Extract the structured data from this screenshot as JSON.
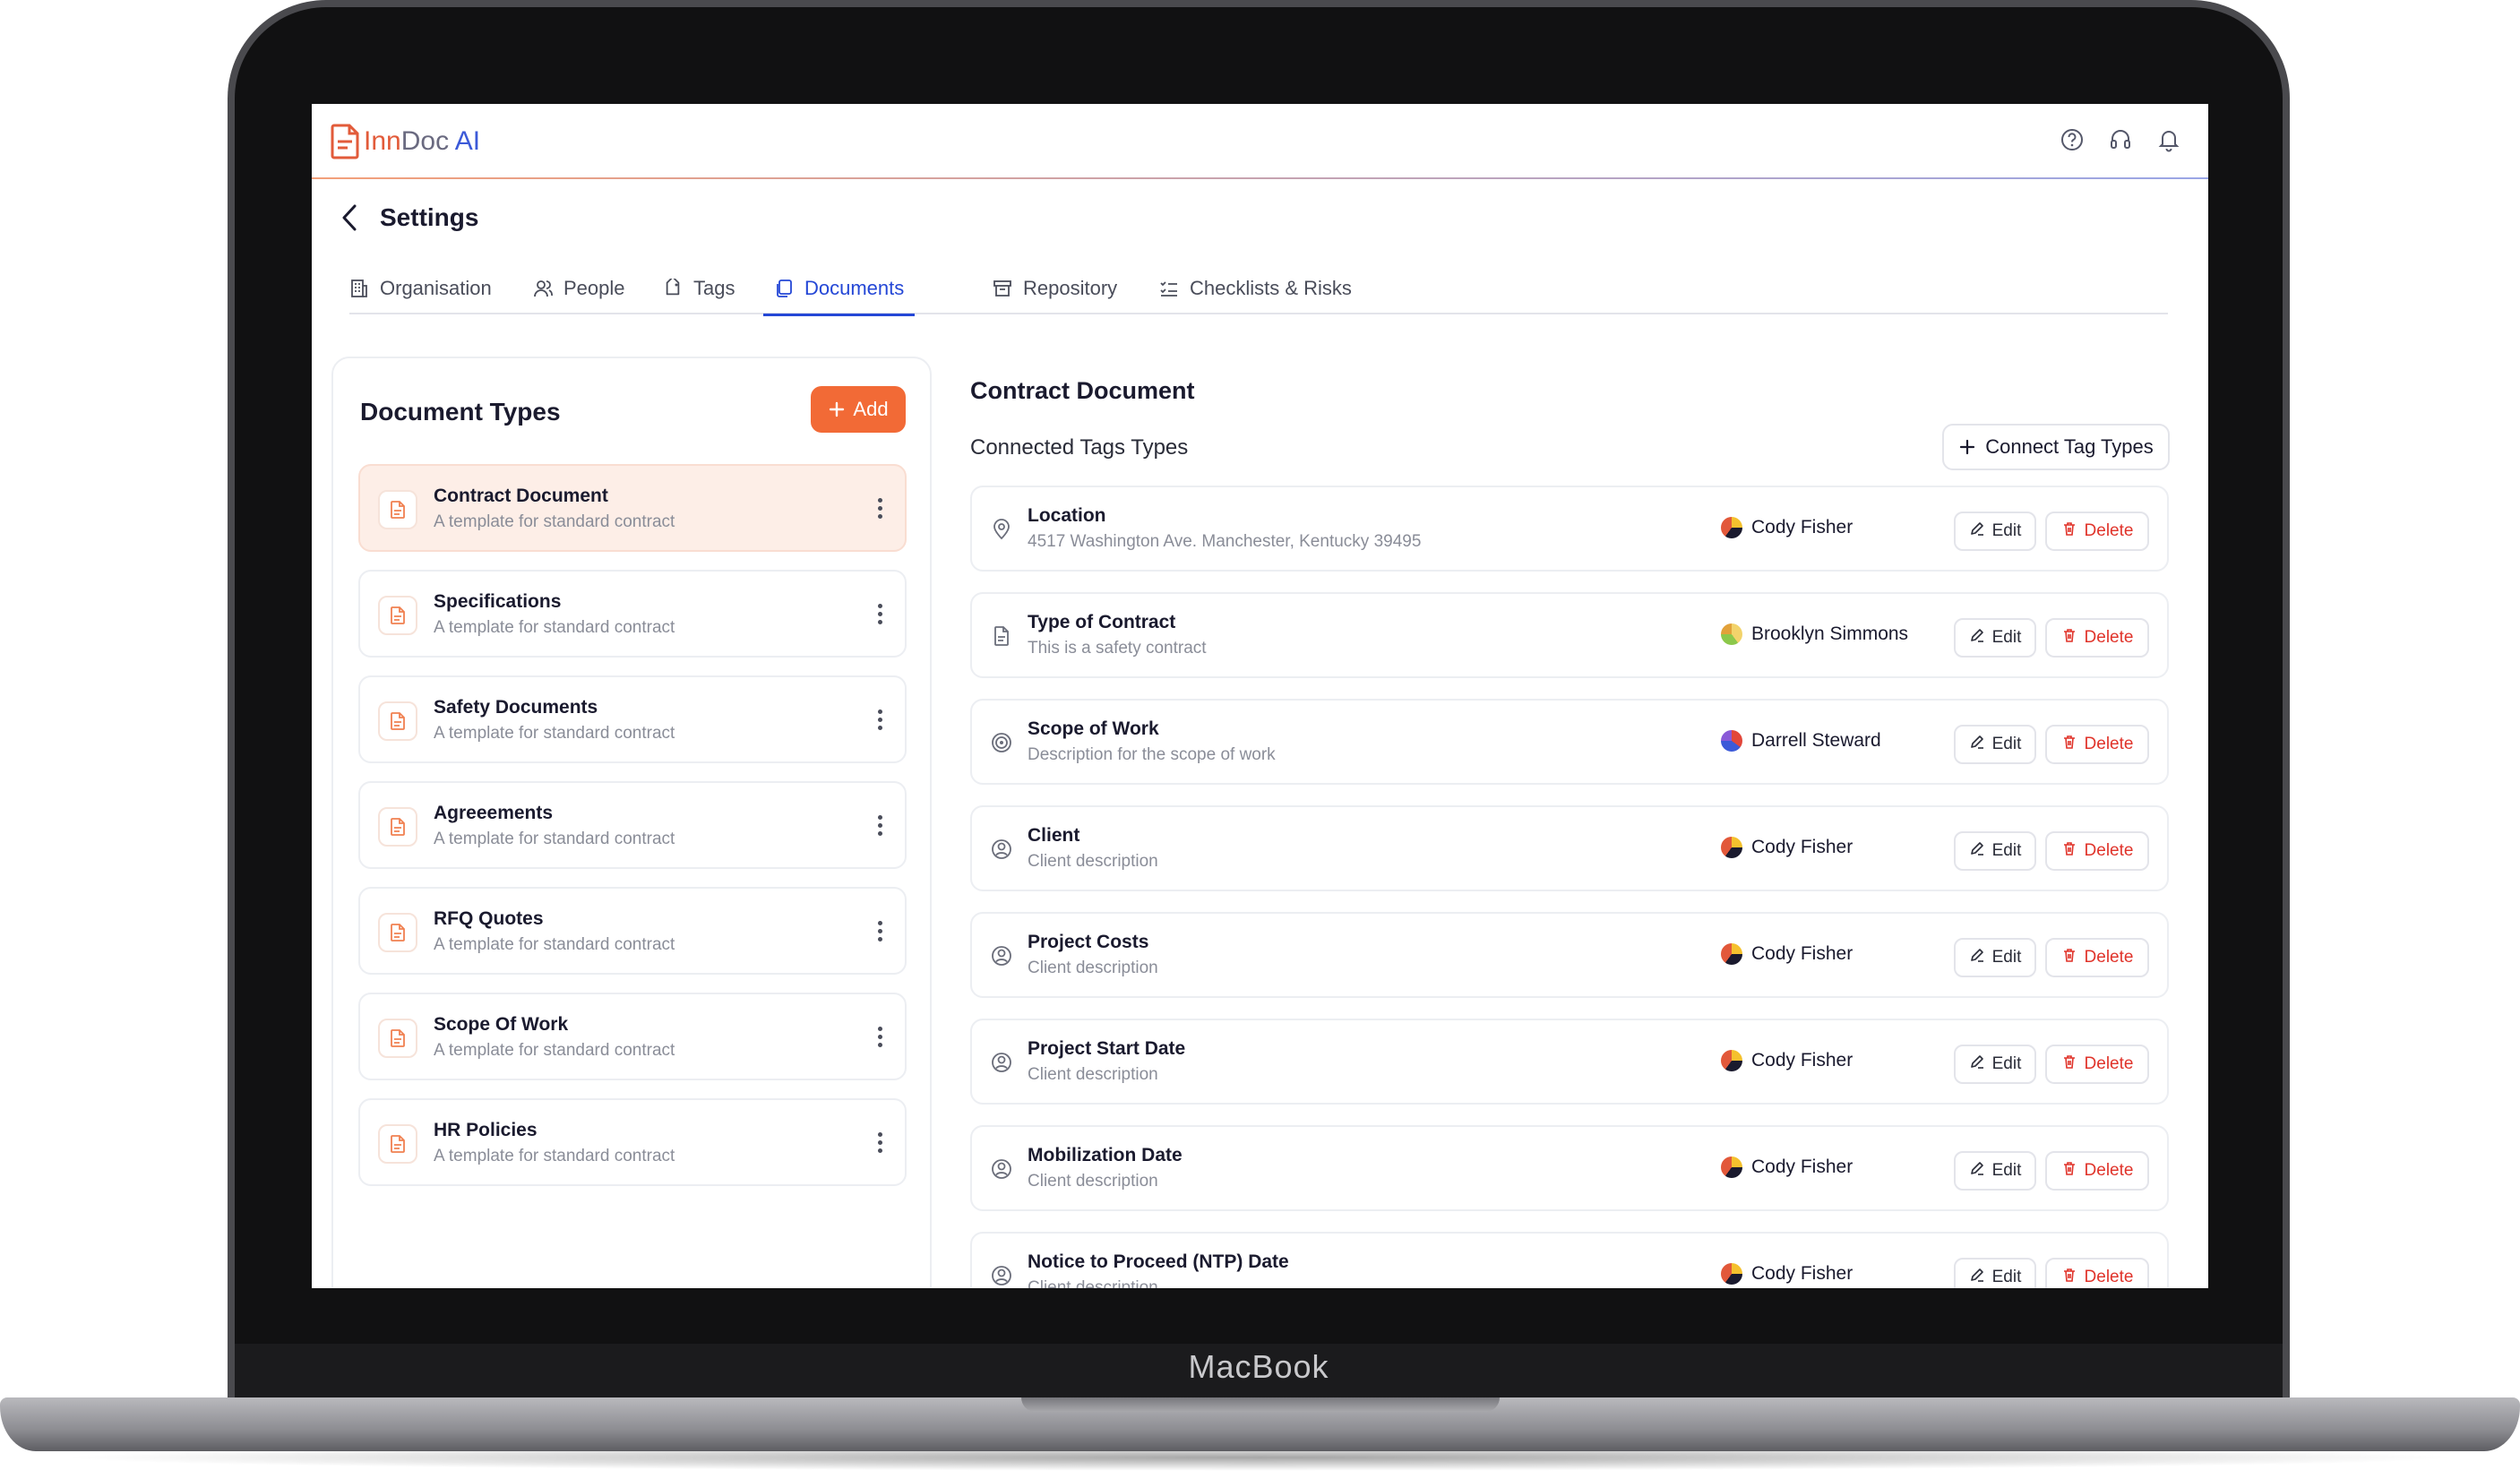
{
  "device": {
    "brand": "MacBook"
  },
  "app": {
    "logo_inn": "Inn",
    "logo_doc": "Doc ",
    "logo_ai": "AI"
  },
  "header": {
    "title": "Settings"
  },
  "tabs": [
    {
      "label": "Organisation",
      "icon": "building-icon"
    },
    {
      "label": "People",
      "icon": "people-icon"
    },
    {
      "label": "Tags",
      "icon": "tag-icon"
    },
    {
      "label": "Documents",
      "icon": "documents-icon",
      "active": true
    },
    {
      "label": "Repository",
      "icon": "archive-icon"
    },
    {
      "label": "Checklists & Risks",
      "icon": "checklist-icon"
    }
  ],
  "document_types": {
    "title": "Document Types",
    "add_label": "Add",
    "items": [
      {
        "name": "Contract Document",
        "desc": "A template for standard contract",
        "selected": true
      },
      {
        "name": "Specifications",
        "desc": "A template for standard contract"
      },
      {
        "name": "Safety Documents",
        "desc": "A template for standard contract"
      },
      {
        "name": "Agreeements",
        "desc": "A template for standard contract"
      },
      {
        "name": "RFQ Quotes",
        "desc": "A template for standard contract"
      },
      {
        "name": "Scope Of Work",
        "desc": "A template for standard contract"
      },
      {
        "name": "HR Policies",
        "desc": "A template for standard contract"
      }
    ]
  },
  "detail": {
    "title": "Contract Document",
    "subtitle": "Connected Tags Types",
    "connect_label": "Connect Tag Types",
    "edit_label": "Edit",
    "delete_label": "Delete",
    "tags": [
      {
        "name": "Location",
        "desc": "4517 Washington Ave. Manchester, Kentucky 39495",
        "owner": "Cody Fisher",
        "icon": "location-pin-icon"
      },
      {
        "name": "Type of Contract",
        "desc": "This is a safety contract",
        "owner": "Brooklyn Simmons",
        "icon": "document-icon"
      },
      {
        "name": "Scope of Work",
        "desc": "Description for the scope of work",
        "owner": "Darrell Steward",
        "icon": "target-icon"
      },
      {
        "name": "Client",
        "desc": "Client description",
        "owner": "Cody Fisher",
        "icon": "user-circle-icon"
      },
      {
        "name": "Project Costs",
        "desc": "Client description",
        "owner": "Cody Fisher",
        "icon": "user-circle-icon"
      },
      {
        "name": "Project Start Date",
        "desc": "Client description",
        "owner": "Cody Fisher",
        "icon": "user-circle-icon"
      },
      {
        "name": "Mobilization Date",
        "desc": "Client description",
        "owner": "Cody Fisher",
        "icon": "user-circle-icon"
      },
      {
        "name": "Notice to Proceed (NTP) Date",
        "desc": "Client description",
        "owner": "Cody Fisher",
        "icon": "user-circle-icon"
      }
    ]
  },
  "colors": {
    "accent": "#f26a36",
    "primary": "#2447d6",
    "danger": "#e0332a"
  }
}
